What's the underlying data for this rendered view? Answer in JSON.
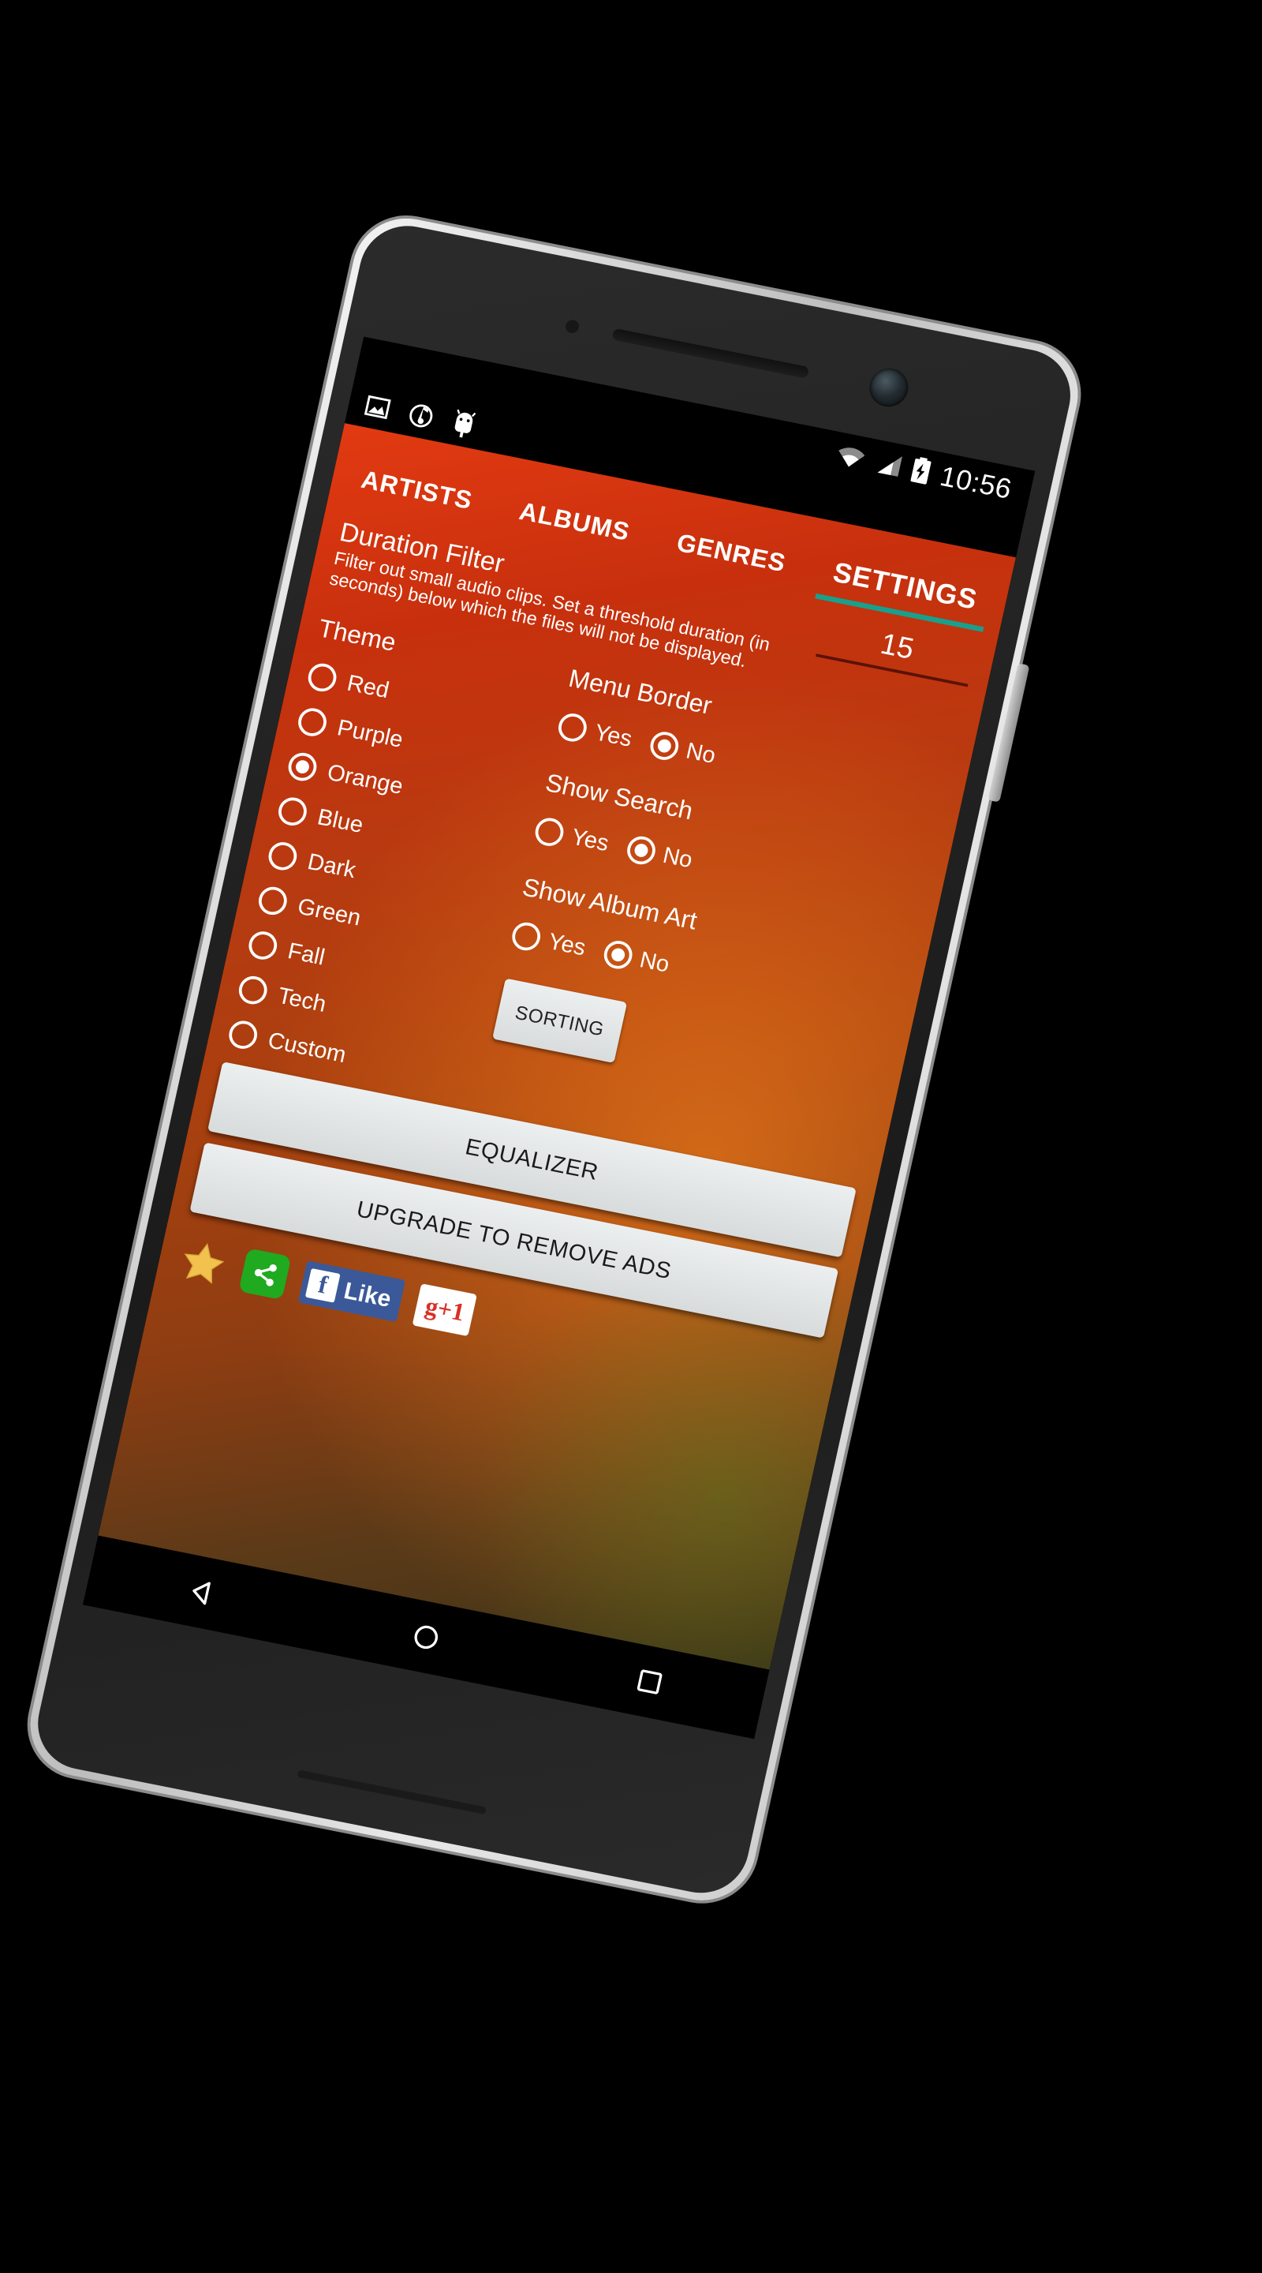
{
  "status_bar": {
    "clock": "10:56",
    "icons": [
      "wifi-icon",
      "cellular-signal-icon",
      "battery-charging-icon"
    ]
  },
  "notification_strip": {
    "icons": [
      "image-icon",
      "music-note-icon",
      "android-icon"
    ]
  },
  "tabs": [
    {
      "label": "ARTISTS",
      "active": false
    },
    {
      "label": "ALBUMS",
      "active": false
    },
    {
      "label": "GENRES",
      "active": false
    },
    {
      "label": "SETTINGS",
      "active": true
    }
  ],
  "duration_filter": {
    "title": "Duration Filter",
    "description": "Filter out small audio clips. Set a threshold duration (in seconds) below which the files will not be displayed.",
    "value": "15"
  },
  "theme": {
    "title": "Theme",
    "selected": "Orange",
    "options": [
      {
        "label": "Red",
        "checked": false
      },
      {
        "label": "Purple",
        "checked": false
      },
      {
        "label": "Orange",
        "checked": true
      },
      {
        "label": "Blue",
        "checked": false
      },
      {
        "label": "Dark",
        "checked": false
      },
      {
        "label": "Green",
        "checked": false
      },
      {
        "label": "Fall",
        "checked": false
      },
      {
        "label": "Tech",
        "checked": false
      },
      {
        "label": "Custom",
        "checked": false
      }
    ]
  },
  "options": [
    {
      "title": "Menu Border",
      "yes_label": "Yes",
      "no_label": "No",
      "selected": "No"
    },
    {
      "title": "Show Search",
      "yes_label": "Yes",
      "no_label": "No",
      "selected": "No"
    },
    {
      "title": "Show Album Art",
      "yes_label": "Yes",
      "no_label": "No",
      "selected": "No"
    }
  ],
  "buttons": {
    "sorting": "SORTING",
    "equalizer": "EQUALIZER",
    "upgrade": "UPGRADE TO REMOVE ADS"
  },
  "social": {
    "star": "star-icon",
    "share": "share-icon",
    "facebook_badge": "f",
    "facebook_label": "Like",
    "gplus_label": "g+1"
  },
  "nav_bar": {
    "back": "back-triangle-icon",
    "home": "home-circle-icon",
    "recents": "recents-square-icon"
  },
  "colors": {
    "accent_teal": "#19a08c",
    "app_orange": "#c8300d",
    "facebook_blue": "#3b5998",
    "gplus_red": "#d93025",
    "share_green": "#1faa1f"
  }
}
